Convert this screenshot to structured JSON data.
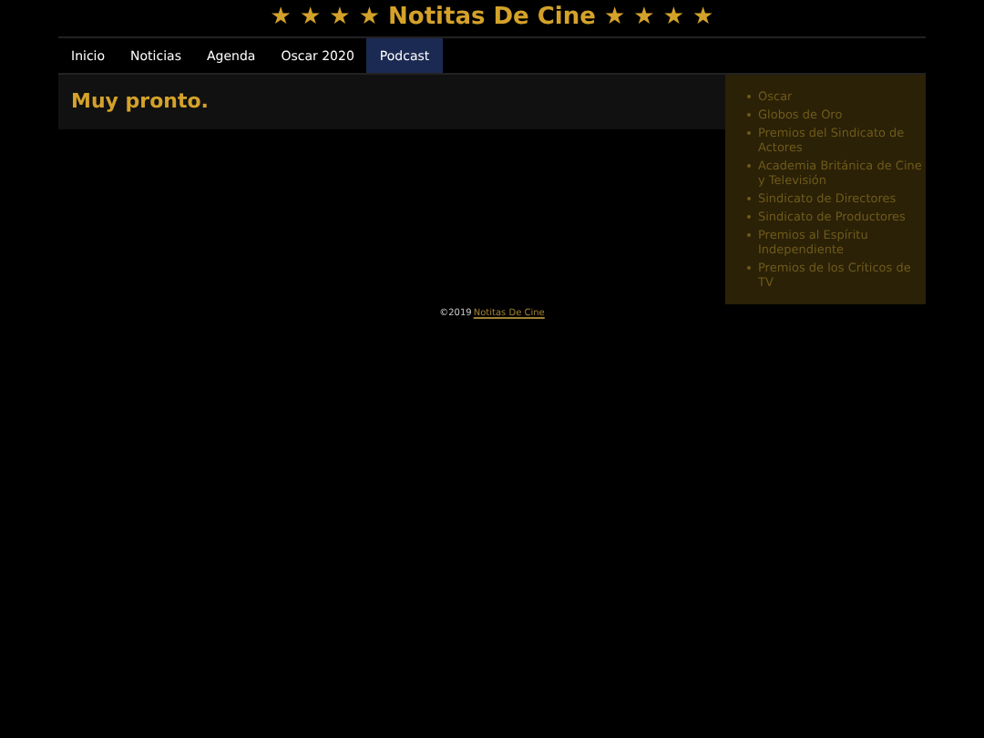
{
  "site_title": "★ ★ ★ ★ Notitas De Cine ★ ★ ★ ★",
  "nav": [
    {
      "label": "Inicio",
      "selected": false
    },
    {
      "label": "Noticias",
      "selected": false
    },
    {
      "label": "Agenda",
      "selected": false
    },
    {
      "label": "Oscar 2020",
      "selected": false
    },
    {
      "label": "Podcast",
      "selected": true
    }
  ],
  "main": {
    "heading": "Muy pronto."
  },
  "sidebar": {
    "items": [
      "Oscar",
      "Globos de Oro",
      "Premios del Sindicato de Actores",
      "Academia Británica de Cine y Televisión",
      "Sindicato de Directores",
      "Sindicato de Productores",
      "Premios al Espíritu Independiente",
      "Premios de los Críticos de TV"
    ]
  },
  "footer": {
    "copyright": "©2019",
    "link": "Notitas De Cine"
  }
}
